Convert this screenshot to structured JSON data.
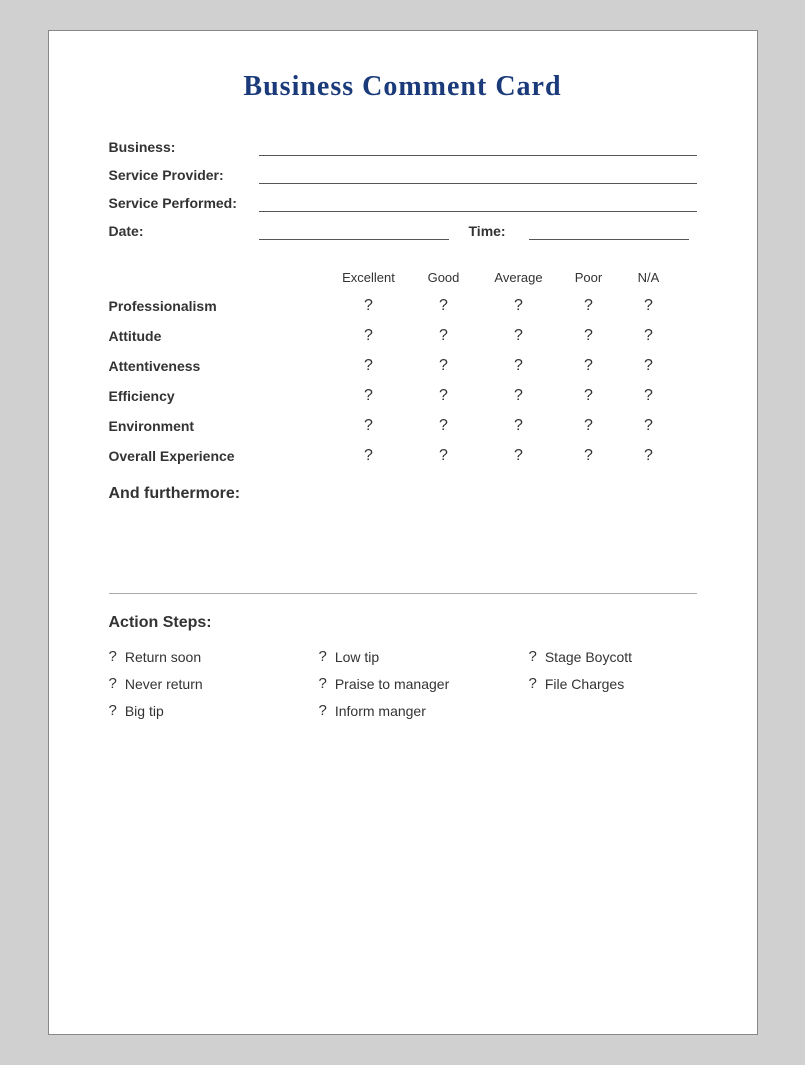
{
  "title": "Business Comment Card",
  "form": {
    "business_label": "Business:",
    "service_provider_label": "Service Provider:",
    "service_performed_label": "Service Performed:",
    "date_label": "Date:",
    "time_label": "Time:"
  },
  "rating_table": {
    "headers": [
      "",
      "Excellent",
      "Good",
      "Average",
      "Poor",
      "N/A"
    ],
    "rows": [
      {
        "label": "Professionalism",
        "values": [
          "?",
          "?",
          "?",
          "?",
          "?"
        ]
      },
      {
        "label": "Attitude",
        "values": [
          "?",
          "?",
          "?",
          "?",
          "?"
        ]
      },
      {
        "label": "Attentiveness",
        "values": [
          "?",
          "?",
          "?",
          "?",
          "?"
        ]
      },
      {
        "label": "Efficiency",
        "values": [
          "?",
          "?",
          "?",
          "?",
          "?"
        ]
      },
      {
        "label": "Environment",
        "values": [
          "?",
          "?",
          "?",
          "?",
          "?"
        ]
      },
      {
        "label": "Overall Experience",
        "values": [
          "?",
          "?",
          "?",
          "?",
          "?"
        ]
      }
    ]
  },
  "furthermore": {
    "title": "And furthermore:"
  },
  "action_steps": {
    "title": "Action Steps:",
    "items": [
      {
        "icon": "?",
        "text": "Return soon"
      },
      {
        "icon": "?",
        "text": "Low tip"
      },
      {
        "icon": "?",
        "text": "Stage Boycott"
      },
      {
        "icon": "?",
        "text": "Never return"
      },
      {
        "icon": "?",
        "text": "Praise to manager"
      },
      {
        "icon": "?",
        "text": "File Charges"
      },
      {
        "icon": "?",
        "text": "Big tip"
      },
      {
        "icon": "?",
        "text": "Inform manger"
      },
      {
        "icon": "",
        "text": ""
      }
    ]
  }
}
